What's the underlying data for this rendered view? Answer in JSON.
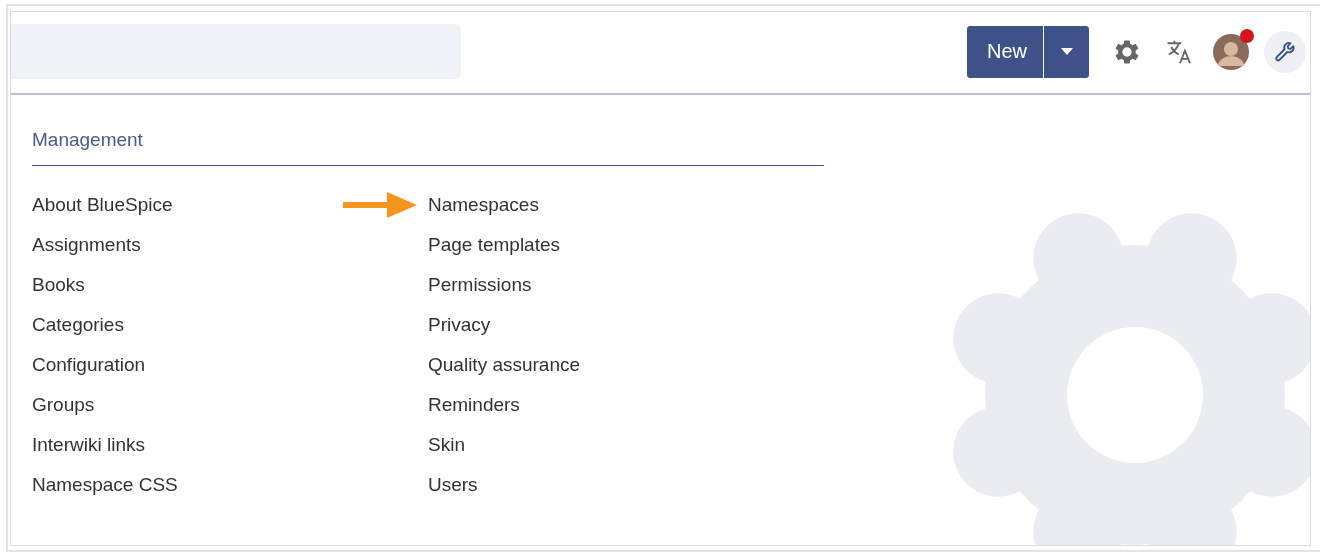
{
  "header": {
    "new_button": "New",
    "avatar": {
      "has_notification": true
    }
  },
  "menu": {
    "heading": "Management",
    "columns": [
      [
        {
          "label": "About BlueSpice",
          "marked": false
        },
        {
          "label": "Assignments",
          "marked": false
        },
        {
          "label": "Books",
          "marked": false
        },
        {
          "label": "Categories",
          "marked": false
        },
        {
          "label": "Configuration",
          "marked": false
        },
        {
          "label": "Groups",
          "marked": false
        },
        {
          "label": "Interwiki links",
          "marked": false
        },
        {
          "label": "Namespace CSS",
          "marked": false
        }
      ],
      [
        {
          "label": "Namespaces",
          "marked": true
        },
        {
          "label": "Page templates",
          "marked": false
        },
        {
          "label": "Permissions",
          "marked": false
        },
        {
          "label": "Privacy",
          "marked": false
        },
        {
          "label": "Quality assurance",
          "marked": false
        },
        {
          "label": "Reminders",
          "marked": false
        },
        {
          "label": "Skin",
          "marked": false
        },
        {
          "label": "Users",
          "marked": false
        }
      ]
    ]
  }
}
